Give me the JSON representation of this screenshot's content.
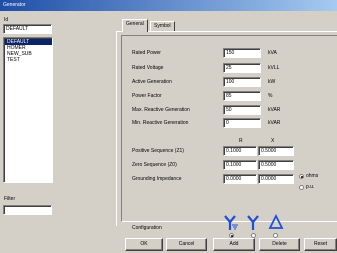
{
  "window": {
    "title": "Generator"
  },
  "left": {
    "id_label": "Id",
    "id_value": "DEFAULT",
    "list_items": [
      "DEFAULT",
      "HOMER",
      "NEW_SUB",
      "TEST"
    ],
    "selected_index": 0,
    "filter_label": "Filter",
    "filter_value": ""
  },
  "tabs": [
    {
      "label": "General",
      "active": true
    },
    {
      "label": "Symbol",
      "active": false
    }
  ],
  "fields": [
    {
      "label": "Rated Power",
      "value": "150",
      "unit": "kVA"
    },
    {
      "label": "Rated Voltage",
      "value": "25",
      "unit": "kVLL"
    },
    {
      "label": "Active Generation",
      "value": "100",
      "unit": "kW"
    },
    {
      "label": "Power Factor",
      "value": "85",
      "unit": "%"
    },
    {
      "label": "Max. Reactive Generation",
      "value": "50",
      "unit": "kVAR"
    },
    {
      "label": "Min. Reactive Generation",
      "value": "0",
      "unit": "kVAR"
    }
  ],
  "impedance": {
    "col_r": "R",
    "col_x": "X",
    "rows": [
      {
        "label": "Positive Sequence (Z1)",
        "r": "0.1000",
        "x": "0.5000"
      },
      {
        "label": "Zero Sequence (Z0)",
        "r": "0.1000",
        "x": "0.5000"
      },
      {
        "label": "Grounding Impedance",
        "r": "0.0000",
        "x": "0.0000"
      }
    ],
    "unit_options": [
      {
        "label": "ohms",
        "selected": true
      },
      {
        "label": "p.u.",
        "selected": false
      }
    ]
  },
  "configuration": {
    "label": "Configuration",
    "selected_index": 0,
    "symbols": [
      "wye-grounded-icon",
      "wye-icon",
      "delta-icon"
    ],
    "symbol_color": "#1e4fd8"
  },
  "buttons": {
    "ok": "OK",
    "cancel": "Cancel",
    "add": "Add",
    "delete": "Delete",
    "reset": "Reset"
  }
}
